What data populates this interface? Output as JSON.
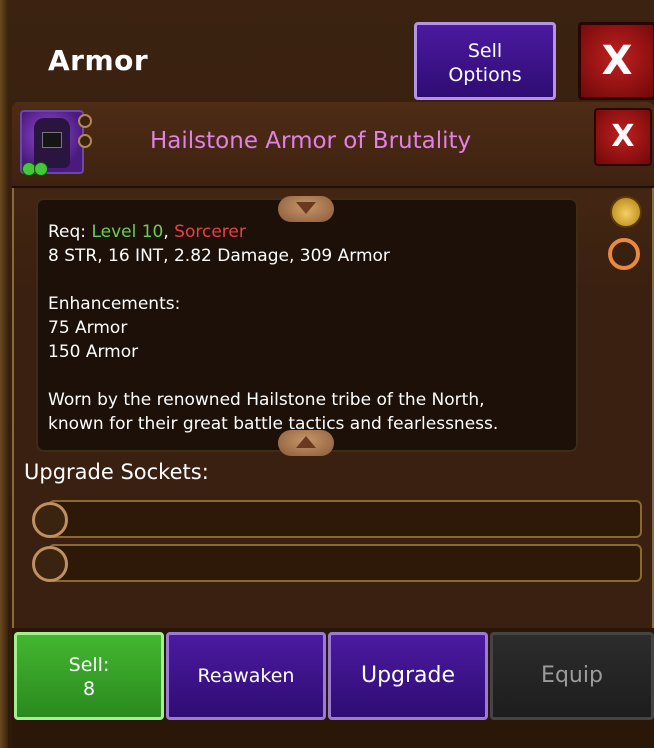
{
  "header": {
    "title": "Armor",
    "sell_options_line1": "Sell",
    "sell_options_line2": "Options",
    "close_label": "X"
  },
  "item": {
    "name": "Hailstone Armor of Brutality",
    "close_label": "X",
    "req_label": "Req:",
    "req_level": "Level 10",
    "req_class": "Sorcerer",
    "stats": "8 STR, 16 INT, 2.82 Damage, 309 Armor",
    "enhancements_label": "Enhancements:",
    "enhancements": [
      "75 Armor",
      "150 Armor"
    ],
    "lore_line1": "Worn by the renowned Hailstone tribe of the North,",
    "lore_line2": "known for their great battle tactics and fearlessness."
  },
  "sockets": {
    "label": "Upgrade Sockets:",
    "count": 2
  },
  "actions": {
    "sell_label": "Sell:",
    "sell_price": "8",
    "reawaken": "Reawaken",
    "upgrade": "Upgrade",
    "equip": "Equip"
  },
  "colors": {
    "title_pink": "#e080e8",
    "req_green": "#6bd04e",
    "req_red": "#e84040",
    "sell_green": "#43b630",
    "purple": "#4b1aa0"
  },
  "icons": [
    "purple-helmet-armor-icon",
    "gold-bag-icon",
    "swap-arrows-icon"
  ]
}
